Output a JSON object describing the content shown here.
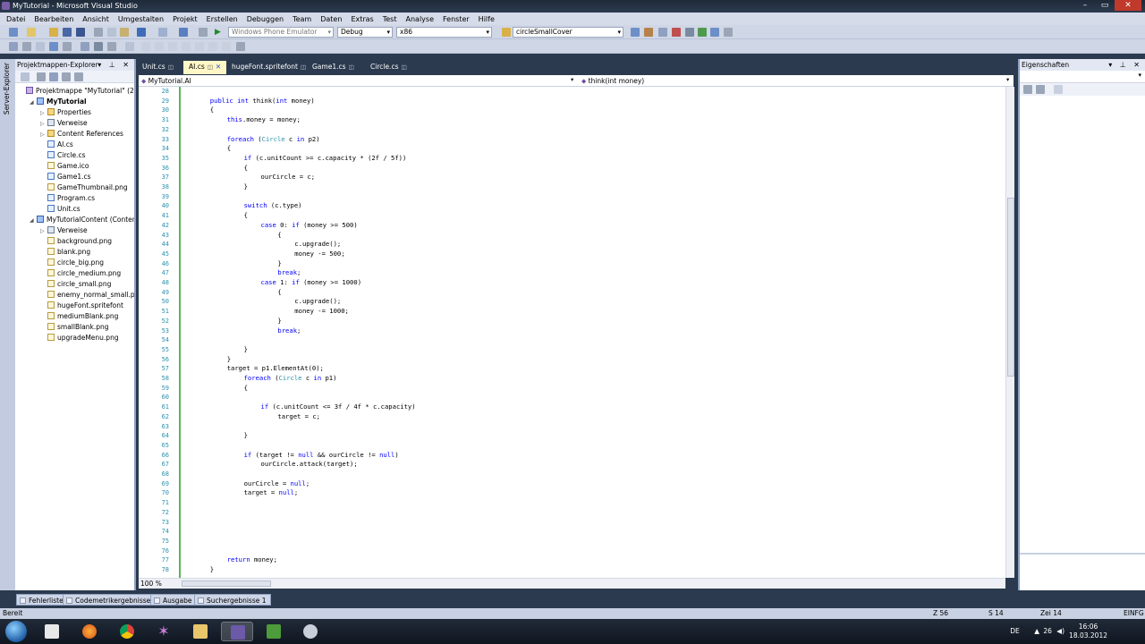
{
  "window": {
    "title": "MyTutorial - Microsoft Visual Studio"
  },
  "menu": [
    "Datei",
    "Bearbeiten",
    "Ansicht",
    "Umgestalten",
    "Projekt",
    "Erstellen",
    "Debuggen",
    "Team",
    "Daten",
    "Extras",
    "Test",
    "Analyse",
    "Fenster",
    "Hilfe"
  ],
  "toolbar": {
    "target_device": "Windows Phone Emulator",
    "configuration": "Debug",
    "platform": "x86",
    "find_text": "circleSmallCover"
  },
  "solution_explorer": {
    "title": "Projektmappen-Explorer",
    "server_explorer": "Server-Explorer",
    "items": [
      {
        "label": "Projektmappe \"MyTutorial\" (2 P",
        "level": 0,
        "icon": "sol",
        "exp": ""
      },
      {
        "label": "MyTutorial",
        "level": 1,
        "icon": "proj",
        "exp": "◢",
        "bold": true
      },
      {
        "label": "Properties",
        "level": 2,
        "icon": "folder",
        "exp": "▷"
      },
      {
        "label": "Verweise",
        "level": 2,
        "icon": "ref",
        "exp": "▷"
      },
      {
        "label": "Content References",
        "level": 2,
        "icon": "folder",
        "exp": "▷"
      },
      {
        "label": "AI.cs",
        "level": 2,
        "icon": "cs",
        "exp": ""
      },
      {
        "label": "Circle.cs",
        "level": 2,
        "icon": "cs",
        "exp": ""
      },
      {
        "label": "Game.ico",
        "level": 2,
        "icon": "png",
        "exp": ""
      },
      {
        "label": "Game1.cs",
        "level": 2,
        "icon": "cs",
        "exp": ""
      },
      {
        "label": "GameThumbnail.png",
        "level": 2,
        "icon": "png",
        "exp": ""
      },
      {
        "label": "Program.cs",
        "level": 2,
        "icon": "cs",
        "exp": ""
      },
      {
        "label": "Unit.cs",
        "level": 2,
        "icon": "cs",
        "exp": ""
      },
      {
        "label": "MyTutorialContent (Conten",
        "level": 1,
        "icon": "proj",
        "exp": "◢"
      },
      {
        "label": "Verweise",
        "level": 2,
        "icon": "ref",
        "exp": "▷"
      },
      {
        "label": "background.png",
        "level": 2,
        "icon": "png",
        "exp": ""
      },
      {
        "label": "blank.png",
        "level": 2,
        "icon": "png",
        "exp": ""
      },
      {
        "label": "circle_big.png",
        "level": 2,
        "icon": "png",
        "exp": ""
      },
      {
        "label": "circle_medium.png",
        "level": 2,
        "icon": "png",
        "exp": ""
      },
      {
        "label": "circle_small.png",
        "level": 2,
        "icon": "png",
        "exp": ""
      },
      {
        "label": "enemy_normal_small.pn",
        "level": 2,
        "icon": "png",
        "exp": ""
      },
      {
        "label": "hugeFont.spritefont",
        "level": 2,
        "icon": "png",
        "exp": ""
      },
      {
        "label": "mediumBlank.png",
        "level": 2,
        "icon": "png",
        "exp": ""
      },
      {
        "label": "smallBlank.png",
        "level": 2,
        "icon": "png",
        "exp": ""
      },
      {
        "label": "upgradeMenu.png",
        "level": 2,
        "icon": "png",
        "exp": ""
      }
    ]
  },
  "editor": {
    "tabs": [
      {
        "label": "Unit.cs",
        "active": false
      },
      {
        "label": "AI.cs",
        "active": true
      },
      {
        "label": "hugeFont.spritefont",
        "active": false
      },
      {
        "label": "Game1.cs",
        "active": false
      },
      {
        "label": "Circle.cs",
        "active": false
      }
    ],
    "nav_class": "MyTutorial.AI",
    "nav_member": "think(int money)",
    "zoom": "100 %",
    "lines": [
      {
        "n": "28",
        "indent": 0,
        "text": ""
      },
      {
        "n": "29",
        "indent": 2,
        "text": "public int think(int money)"
      },
      {
        "n": "30",
        "indent": 2,
        "text": "{"
      },
      {
        "n": "31",
        "indent": 3,
        "text": "this.money = money;"
      },
      {
        "n": "32",
        "indent": 0,
        "text": ""
      },
      {
        "n": "33",
        "indent": 3,
        "text": "foreach (Circle c in p2)"
      },
      {
        "n": "34",
        "indent": 3,
        "text": "{"
      },
      {
        "n": "35",
        "indent": 4,
        "text": "if (c.unitCount >= c.capacity * (2f / 5f))"
      },
      {
        "n": "36",
        "indent": 4,
        "text": "{"
      },
      {
        "n": "37",
        "indent": 5,
        "text": "ourCircle = c;"
      },
      {
        "n": "38",
        "indent": 4,
        "text": "}"
      },
      {
        "n": "39",
        "indent": 0,
        "text": ""
      },
      {
        "n": "40",
        "indent": 4,
        "text": "switch (c.type)"
      },
      {
        "n": "41",
        "indent": 4,
        "text": "{"
      },
      {
        "n": "42",
        "indent": 5,
        "text": "case 0: if (money >= 500)"
      },
      {
        "n": "43",
        "indent": 6,
        "text": "{"
      },
      {
        "n": "44",
        "indent": 7,
        "text": "c.upgrade();"
      },
      {
        "n": "45",
        "indent": 7,
        "text": "money -= 500;"
      },
      {
        "n": "46",
        "indent": 6,
        "text": "}"
      },
      {
        "n": "47",
        "indent": 6,
        "text": "break;"
      },
      {
        "n": "48",
        "indent": 5,
        "text": "case 1: if (money >= 1000)"
      },
      {
        "n": "49",
        "indent": 6,
        "text": "{"
      },
      {
        "n": "50",
        "indent": 7,
        "text": "c.upgrade();"
      },
      {
        "n": "51",
        "indent": 7,
        "text": "money -= 1000;"
      },
      {
        "n": "52",
        "indent": 6,
        "text": "}"
      },
      {
        "n": "53",
        "indent": 6,
        "text": "break;"
      },
      {
        "n": "54",
        "indent": 0,
        "text": ""
      },
      {
        "n": "55",
        "indent": 4,
        "text": "}"
      },
      {
        "n": "56",
        "indent": 3,
        "text": "}"
      },
      {
        "n": "57",
        "indent": 3,
        "text": "target = p1.ElementAt(0);"
      },
      {
        "n": "58",
        "indent": 4,
        "text": "foreach (Circle c in p1)"
      },
      {
        "n": "59",
        "indent": 4,
        "text": "{"
      },
      {
        "n": "60",
        "indent": 0,
        "text": ""
      },
      {
        "n": "61",
        "indent": 5,
        "text": "if (c.unitCount <= 3f / 4f * c.capacity)"
      },
      {
        "n": "62",
        "indent": 6,
        "text": "target = c;"
      },
      {
        "n": "63",
        "indent": 0,
        "text": ""
      },
      {
        "n": "64",
        "indent": 4,
        "text": "}"
      },
      {
        "n": "65",
        "indent": 0,
        "text": ""
      },
      {
        "n": "66",
        "indent": 4,
        "text": "if (target != null && ourCircle != null)"
      },
      {
        "n": "67",
        "indent": 5,
        "text": "ourCircle.attack(target);"
      },
      {
        "n": "68",
        "indent": 0,
        "text": ""
      },
      {
        "n": "69",
        "indent": 4,
        "text": "ourCircle = null;"
      },
      {
        "n": "70",
        "indent": 4,
        "text": "target = null;"
      },
      {
        "n": "71",
        "indent": 0,
        "text": ""
      },
      {
        "n": "72",
        "indent": 0,
        "text": ""
      },
      {
        "n": "73",
        "indent": 0,
        "text": ""
      },
      {
        "n": "74",
        "indent": 0,
        "text": ""
      },
      {
        "n": "75",
        "indent": 0,
        "text": ""
      },
      {
        "n": "76",
        "indent": 0,
        "text": ""
      },
      {
        "n": "77",
        "indent": 3,
        "text": "return money;"
      },
      {
        "n": "78",
        "indent": 2,
        "text": "}"
      }
    ]
  },
  "properties": {
    "title": "Eigenschaften"
  },
  "bottom_tabs": [
    "Fehlerliste",
    "Codemetrikergebnisse",
    "Ausgabe",
    "Suchergebnisse 1"
  ],
  "status": {
    "ready": "Bereit",
    "line": "Z 56",
    "col": "S 14",
    "char": "Zei 14",
    "mode": "EINFG"
  },
  "taskbar": {
    "lang": "DE",
    "volume": "26",
    "time": "16:06",
    "date": "18.03.2012"
  },
  "colors": {
    "keyword": "#0000ff",
    "type": "#2b91af",
    "chrome": "#2b3a4e",
    "active_tab": "#fff7c6"
  }
}
